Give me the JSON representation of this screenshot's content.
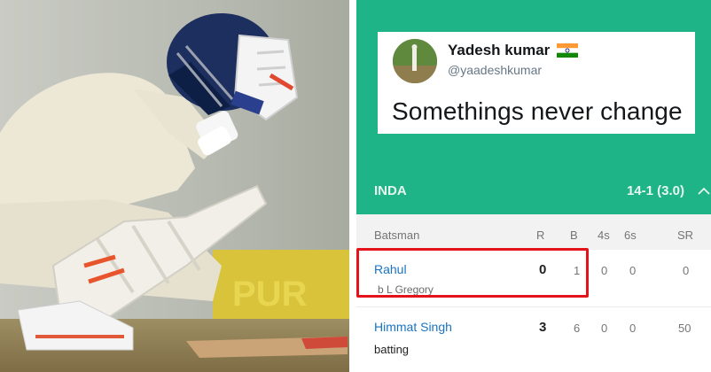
{
  "tweet": {
    "display_name": "Yadesh kumar",
    "handle": "@yaadeshkumar",
    "text": "Somethings never change"
  },
  "scorecard": {
    "team": "INDA",
    "score": "14-1 (3.0)",
    "columns": [
      "Batsman",
      "R",
      "B",
      "4s",
      "6s",
      "SR"
    ],
    "rows": [
      {
        "name": "Rahul",
        "dismissal": "b L Gregory",
        "R": "0",
        "B": "1",
        "4s": "0",
        "6s": "0",
        "SR": "0"
      },
      {
        "name": "Himmat Singh",
        "dismissal": "batting",
        "R": "3",
        "B": "6",
        "4s": "0",
        "6s": "0",
        "SR": "50"
      }
    ]
  },
  "colors": {
    "panel": "#1fb487",
    "highlight": "#e3121b",
    "link": "#1a73c2"
  },
  "icons": [
    "india-flag-icon",
    "chevron-up-icon"
  ]
}
